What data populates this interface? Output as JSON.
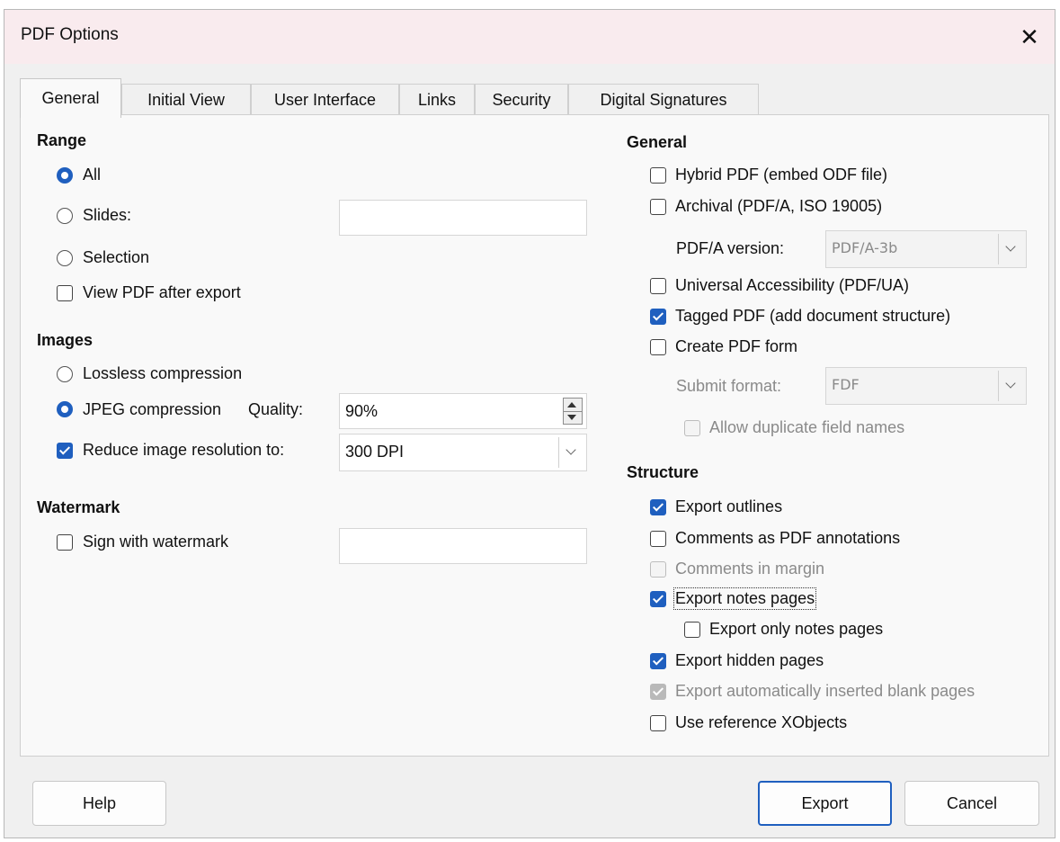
{
  "window": {
    "title": "PDF Options",
    "close_glyph": "✕"
  },
  "tabs": [
    "General",
    "Initial View",
    "User Interface",
    "Links",
    "Security",
    "Digital Signatures"
  ],
  "active_tab": "General",
  "range": {
    "heading": "Range",
    "all": "All",
    "slides": "Slides:",
    "slides_value": "",
    "selection": "Selection",
    "view_after": "View PDF after export",
    "selected": "All",
    "view_after_checked": false
  },
  "images": {
    "heading": "Images",
    "lossless": "Lossless compression",
    "jpeg": "JPEG compression",
    "quality_label": "Quality:",
    "quality_value": "90%",
    "reduce": "Reduce image resolution to:",
    "reduce_checked": true,
    "resolution_value": "300 DPI",
    "selected": "JPEG compression"
  },
  "watermark": {
    "heading": "Watermark",
    "sign": "Sign with watermark",
    "sign_checked": false,
    "value": ""
  },
  "general": {
    "heading": "General",
    "hybrid": "Hybrid PDF (embed ODF file)",
    "archival": "Archival (PDF/A, ISO 19005)",
    "pdfa_label": "PDF/A version:",
    "pdfa_value": "PDF/A-3b",
    "ua": "Universal Accessibility (PDF/UA)",
    "tagged": "Tagged PDF (add document structure)",
    "form": "Create PDF form",
    "submit_label": "Submit format:",
    "submit_value": "FDF",
    "dup": "Allow duplicate field names"
  },
  "structure": {
    "heading": "Structure",
    "outlines": "Export outlines",
    "comments_pdf": "Comments as PDF annotations",
    "comments_margin": "Comments in margin",
    "notes": "Export notes pages",
    "only_notes": "Export only notes pages",
    "hidden": "Export hidden pages",
    "blank": "Export automatically inserted blank pages",
    "xobjects": "Use reference XObjects"
  },
  "buttons": {
    "help": "Help",
    "export": "Export",
    "cancel": "Cancel"
  },
  "colors": {
    "accent": "#1f5fbf",
    "titlebar": "#f9ebee"
  }
}
